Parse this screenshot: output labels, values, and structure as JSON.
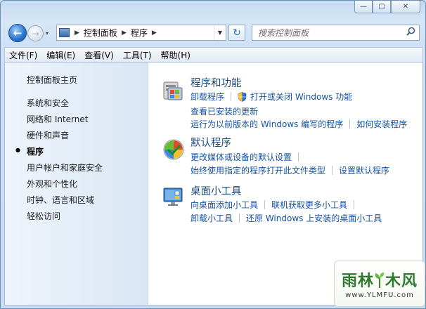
{
  "window": {
    "caption": {
      "minimize": "—",
      "maximize": "▢",
      "close": "✕"
    }
  },
  "nav": {
    "back_symbol": "←",
    "forward_symbol": "→",
    "history_symbol": "▾",
    "breadcrumbs": [
      "控制面板",
      "程序"
    ],
    "breadcrumb_sep": "▶",
    "dropdown_symbol": "▼",
    "refresh_symbol": "↻",
    "search_placeholder": "搜索控制面板",
    "search_symbol": "⚲"
  },
  "menu": {
    "items": [
      "文件(F)",
      "编辑(E)",
      "查看(V)",
      "工具(T)",
      "帮助(H)"
    ]
  },
  "sidebar": {
    "items": [
      {
        "label": "控制面板主页",
        "current": false
      },
      {
        "label": "系统和安全",
        "current": false
      },
      {
        "label": "网络和 Internet",
        "current": false
      },
      {
        "label": "硬件和声音",
        "current": false
      },
      {
        "label": "程序",
        "current": true
      },
      {
        "label": "用户帐户和家庭安全",
        "current": false
      },
      {
        "label": "外观和个性化",
        "current": false
      },
      {
        "label": "时钟、语言和区域",
        "current": false
      },
      {
        "label": "轻松访问",
        "current": false
      }
    ],
    "bullet": "●"
  },
  "categories": [
    {
      "title": "程序和功能",
      "icon": "programs-features-icon",
      "lines": [
        [
          "卸载程序",
          "打开或关闭 Windows 功能"
        ],
        [
          "查看已安装的更新"
        ],
        [
          "运行为以前版本的 Windows 编写的程序",
          "如何安装程序"
        ]
      ]
    },
    {
      "title": "默认程序",
      "icon": "default-programs-icon",
      "lines": [
        [
          "更改媒体或设备的默认设置"
        ],
        [
          "始终使用指定的程序打开此文件类型",
          "设置默认程序"
        ]
      ]
    },
    {
      "title": "桌面小工具",
      "icon": "desktop-gadgets-icon",
      "lines": [
        [
          "向桌面添加小工具",
          "联机获取更多小工具"
        ],
        [
          "卸载小工具",
          "还原 Windows 上安装的桌面小工具"
        ]
      ]
    }
  ],
  "watermark": {
    "title_left": "雨林",
    "title_right": "木风",
    "url": "www.YLMFU.com"
  },
  "colors": {
    "link": "#1553a1",
    "category_title": "#1e4a7a",
    "sidebar_bg": "#e4edf8"
  }
}
